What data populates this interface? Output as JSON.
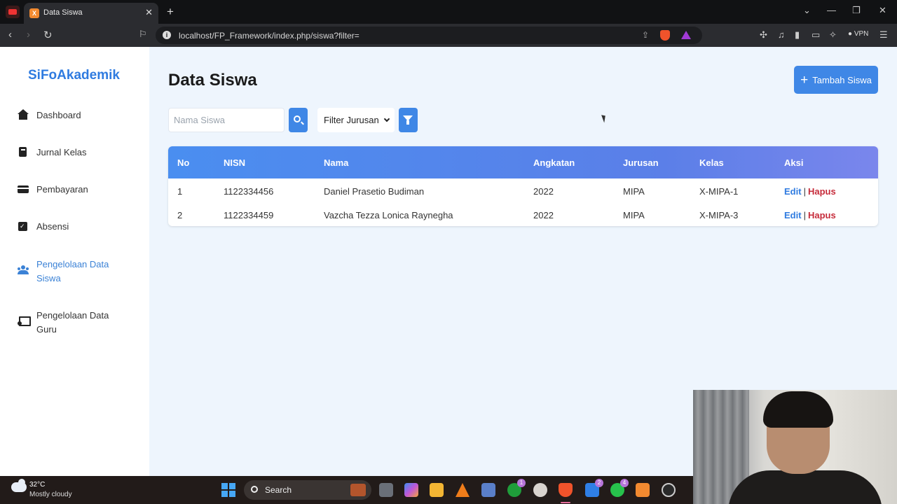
{
  "browser": {
    "tab_title": "Data Siswa",
    "tab_favicon": "XAMPP",
    "url": "localhost/FP_Framework/index.php/siswa?filter=",
    "vpn_label": "VPN"
  },
  "sidebar": {
    "brand": "SiFoAkademik",
    "items": [
      {
        "label": "Dashboard",
        "icon": "home-icon"
      },
      {
        "label": "Jurnal Kelas",
        "icon": "book-icon"
      },
      {
        "label": "Pembayaran",
        "icon": "credit-card-icon"
      },
      {
        "label": "Absensi",
        "icon": "calendar-check-icon"
      },
      {
        "label": "Pengelolaan Data Siswa",
        "icon": "users-icon",
        "active": true
      },
      {
        "label": "Pengelolaan Data Guru",
        "icon": "teacher-icon"
      }
    ]
  },
  "main": {
    "title": "Data Siswa",
    "add_button": "Tambah Siswa",
    "search_placeholder": "Nama Siswa",
    "filter_label": "Filter Jurusan"
  },
  "table": {
    "headers": [
      "No",
      "NISN",
      "Nama",
      "Angkatan",
      "Jurusan",
      "Kelas",
      "Aksi"
    ],
    "rows": [
      {
        "no": "1",
        "nisn": "1122334456",
        "nama": "Daniel Prasetio Budiman",
        "angkatan": "2022",
        "jurusan": "MIPA",
        "kelas": "X-MIPA-1"
      },
      {
        "no": "2",
        "nisn": "1122334459",
        "nama": "Vazcha Tezza Lonica Raynegha",
        "angkatan": "2022",
        "jurusan": "MIPA",
        "kelas": "X-MIPA-3"
      }
    ],
    "action_edit": "Edit",
    "action_separator": "|",
    "action_delete": "Hapus"
  },
  "taskbar": {
    "temperature": "32°C",
    "condition": "Mostly cloudy",
    "search_label": "Search"
  },
  "colors": {
    "primary": "#3f87e6",
    "brand": "#2f7be0",
    "delete": "#c62b3a",
    "page_bg": "#eef5fd"
  }
}
